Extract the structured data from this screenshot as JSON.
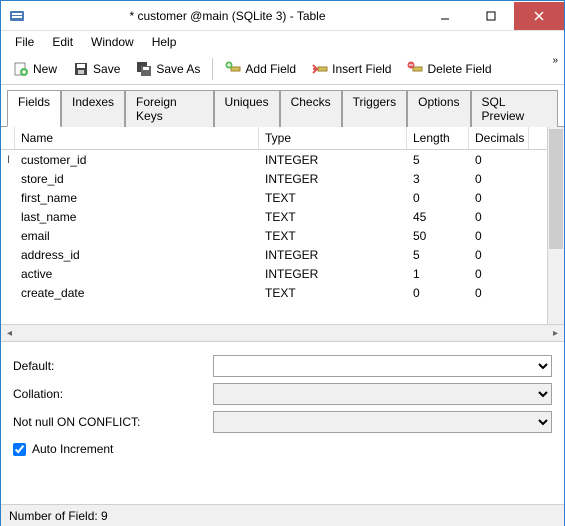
{
  "window": {
    "title": "* customer @main (SQLite 3) - Table"
  },
  "menu": {
    "file": "File",
    "edit": "Edit",
    "window": "Window",
    "help": "Help"
  },
  "toolbar": {
    "new": "New",
    "save": "Save",
    "save_as": "Save As",
    "add_field": "Add Field",
    "insert_field": "Insert Field",
    "delete_field": "Delete Field"
  },
  "tabs": {
    "fields": "Fields",
    "indexes": "Indexes",
    "foreign_keys": "Foreign Keys",
    "uniques": "Uniques",
    "checks": "Checks",
    "triggers": "Triggers",
    "options": "Options",
    "sql_preview": "SQL Preview"
  },
  "columns": {
    "name": "Name",
    "type": "Type",
    "length": "Length",
    "decimals": "Decimals"
  },
  "rows": [
    {
      "name": "customer_id",
      "type": "INTEGER",
      "length": "5",
      "decimals": "0",
      "cursor": true
    },
    {
      "name": "store_id",
      "type": "INTEGER",
      "length": "3",
      "decimals": "0"
    },
    {
      "name": "first_name",
      "type": "TEXT",
      "length": "0",
      "decimals": "0"
    },
    {
      "name": "last_name",
      "type": "TEXT",
      "length": "45",
      "decimals": "0"
    },
    {
      "name": "email",
      "type": "TEXT",
      "length": "50",
      "decimals": "0"
    },
    {
      "name": "address_id",
      "type": "INTEGER",
      "length": "5",
      "decimals": "0"
    },
    {
      "name": "active",
      "type": "INTEGER",
      "length": "1",
      "decimals": "0"
    },
    {
      "name": "create_date",
      "type": "TEXT",
      "length": "0",
      "decimals": "0"
    }
  ],
  "form": {
    "default_label": "Default:",
    "collation_label": "Collation:",
    "notnull_label": "Not null ON CONFLICT:",
    "autoincrement_label": "Auto Increment",
    "default_value": "",
    "collation_value": "",
    "notnull_value": "",
    "autoincrement_checked": true
  },
  "status": {
    "text": "Number of Field: 9"
  }
}
